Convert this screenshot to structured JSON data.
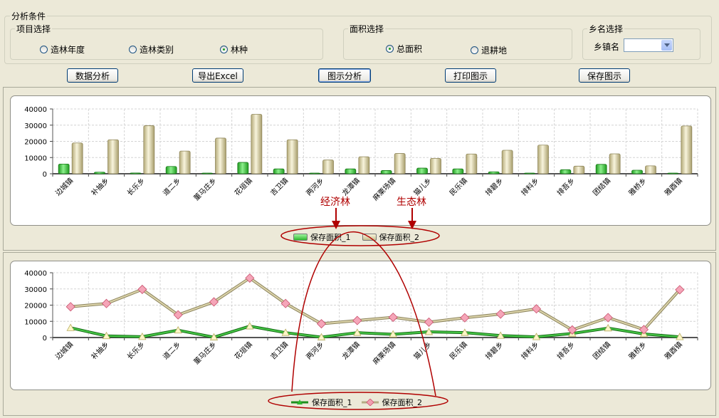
{
  "conditions": {
    "title": "分析条件",
    "project": {
      "legend": "项目选择",
      "options": [
        {
          "label": "造林年度",
          "selected": false
        },
        {
          "label": "造林类别",
          "selected": false
        },
        {
          "label": "林种",
          "selected": true
        }
      ]
    },
    "area": {
      "legend": "面积选择",
      "options": [
        {
          "label": "总面积",
          "selected": true
        },
        {
          "label": "退耕地",
          "selected": false
        }
      ]
    },
    "township": {
      "legend": "乡名选择",
      "label": "乡镇名",
      "value": ""
    }
  },
  "toolbar": {
    "data_analysis": "数据分析",
    "export_excel": "导出Excel",
    "chart_analysis": "图示分析",
    "print_chart": "打印图示",
    "save_chart": "保存图示"
  },
  "annotations": {
    "economic_forest": "经济林",
    "ecological_forest": "生态林"
  },
  "colors": {
    "series1": "#2fb82f",
    "series2": "#c8bf8e",
    "annotation": "#b00000"
  },
  "chart_data": [
    {
      "type": "bar",
      "categories": [
        "边城镇",
        "补抽乡",
        "长乐乡",
        "道二乡",
        "董马庄乡",
        "花垣镇",
        "吉卫镇",
        "两河乡",
        "龙潭镇",
        "麻栗场镇",
        "猫儿乡",
        "民乐镇",
        "排碧乡",
        "排料乡",
        "排吾乡",
        "团结镇",
        "雅桥乡",
        "雅酉镇"
      ],
      "series": [
        {
          "name": "保存面积_1",
          "values": [
            6000,
            1000,
            500,
            4500,
            200,
            7000,
            3000,
            200,
            3000,
            2000,
            3500,
            3000,
            1200,
            400,
            2500,
            5800,
            2200,
            400
          ]
        },
        {
          "name": "保存面积_2",
          "values": [
            19000,
            21000,
            29700,
            14000,
            22000,
            36700,
            21000,
            8500,
            10500,
            12500,
            9500,
            12200,
            14500,
            17700,
            4700,
            12300,
            4900,
            29500
          ]
        }
      ],
      "ylim": [
        0,
        40000
      ],
      "yticks": [
        "0",
        "10000",
        "20000",
        "30000",
        "40000"
      ],
      "grid": true,
      "legend": "bottom"
    },
    {
      "type": "line",
      "categories": [
        "边城镇",
        "补抽乡",
        "长乐乡",
        "道二乡",
        "董马庄乡",
        "花垣镇",
        "吉卫镇",
        "两河乡",
        "龙潭镇",
        "麻栗场镇",
        "猫儿乡",
        "民乐镇",
        "排碧乡",
        "排料乡",
        "排吾乡",
        "团结镇",
        "雅桥乡",
        "雅酉镇"
      ],
      "series": [
        {
          "name": "保存面积_1",
          "values": [
            6000,
            1000,
            500,
            4500,
            200,
            7000,
            3000,
            200,
            3000,
            2000,
            3500,
            3000,
            1200,
            400,
            2500,
            5800,
            2200,
            400
          ]
        },
        {
          "name": "保存面积_2",
          "values": [
            19000,
            21000,
            29700,
            14000,
            22000,
            36700,
            21000,
            8500,
            10500,
            12500,
            9500,
            12200,
            14500,
            17700,
            4700,
            12300,
            4900,
            29500
          ]
        }
      ],
      "ylim": [
        0,
        40000
      ],
      "yticks": [
        "0",
        "10000",
        "20000",
        "30000",
        "40000"
      ],
      "grid": true,
      "legend": "bottom"
    }
  ]
}
